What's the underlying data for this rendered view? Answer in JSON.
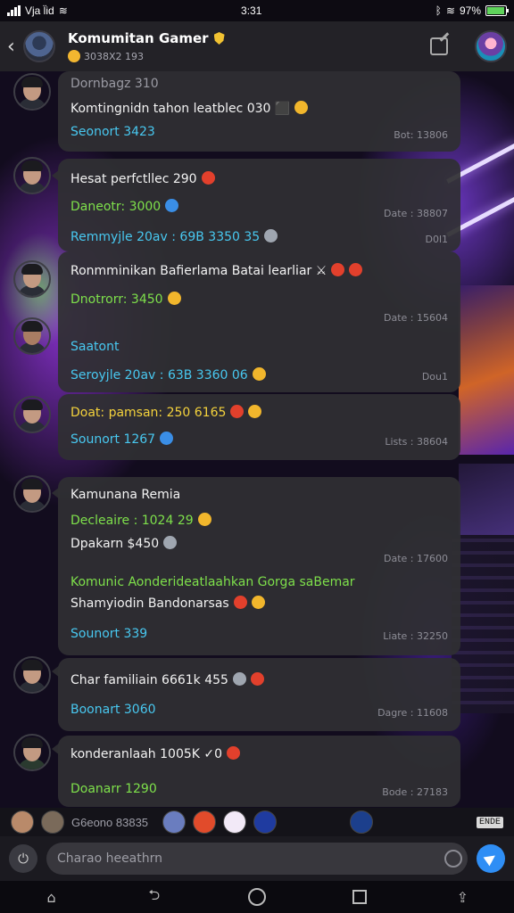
{
  "status_bar": {
    "carrier": "Vja l̈id",
    "time": "3:31",
    "battery": "97%",
    "battery_level": 0.97
  },
  "header": {
    "back_label": "‹",
    "title": "Komumitan Gamer",
    "subtitle": "3038X2 193"
  },
  "messages": [
    {
      "lines": [
        {
          "text": "Dornbagz 310",
          "color": "grey"
        },
        {
          "text": "Komtingnidn tahon leatblec 030 ⬛",
          "color": "white"
        },
        {
          "text": "Seonort 3423",
          "color": "cyan"
        }
      ],
      "date": "Bot: 13806"
    },
    {
      "lines": [
        {
          "text": "Hesat perfctllec 290",
          "color": "white"
        },
        {
          "text": "Daneotr: 3000",
          "color": "green"
        },
        {
          "text": "Remmyjle 20av : 69B 3350 35",
          "color": "cyan"
        }
      ],
      "date": "Date : 38807",
      "date2": "D0l1"
    },
    {
      "lines": [
        {
          "text": "Ronmminikan Bafierlama Batai learliar ⚔",
          "color": "white"
        },
        {
          "text": "Dnotrorr: 3450",
          "color": "green"
        },
        {
          "text": "Saatont",
          "color": "cyan"
        },
        {
          "text": "Seroyjle 20av : 63B 3360 06",
          "color": "cyan"
        }
      ],
      "date": "Date : 15604",
      "date2": "Dou1"
    },
    {
      "lines": [
        {
          "text": "Doat: pamsan: 250 6165",
          "color": "white"
        },
        {
          "text": "Sounort 1267",
          "color": "cyan"
        }
      ],
      "date": "Lists : 38604"
    },
    {
      "lines": [
        {
          "text": "Kamunana Remia",
          "color": "white"
        },
        {
          "text": "Decleaire : 1024 29",
          "color": "green"
        },
        {
          "text": "Dpakarn $450",
          "color": "white"
        },
        {
          "text": "Komunic Aonderideatlaahkan Gorga saBemar",
          "color": "green"
        },
        {
          "text": "Shamyiodin Bandonarsas",
          "color": "white"
        },
        {
          "text": "Sounort 339",
          "color": "cyan"
        }
      ],
      "date": "Date : 17600",
      "date2": "Liate : 32250"
    },
    {
      "lines": [
        {
          "text": "Char familiain 6661k 455",
          "color": "white"
        },
        {
          "text": "Boonart 3060",
          "color": "cyan"
        }
      ],
      "date": "Dagre : 11608"
    },
    {
      "lines": [
        {
          "text": "konderanlaah 1005K ✓0",
          "color": "white"
        },
        {
          "text": "Doanarr 1290",
          "color": "green"
        }
      ],
      "date": "Bode : 27183"
    }
  ],
  "reaction_strip": {
    "count_label": "G6eono 83835",
    "tag": "ENDE"
  },
  "composer": {
    "placeholder": "Charao heeathrn"
  },
  "colors": {
    "accent_send": "#2f8ef5",
    "green_text": "#7ee04b",
    "cyan_text": "#48c8f0"
  },
  "icons": {
    "back": "chevron-left-icon",
    "edit": "edit-icon",
    "attach": "attach-icon",
    "emoji": "emoji-icon",
    "send": "send-icon",
    "nav": [
      "home-icon",
      "back-icon",
      "home-circle-icon",
      "recents-icon",
      "share-icon"
    ]
  }
}
